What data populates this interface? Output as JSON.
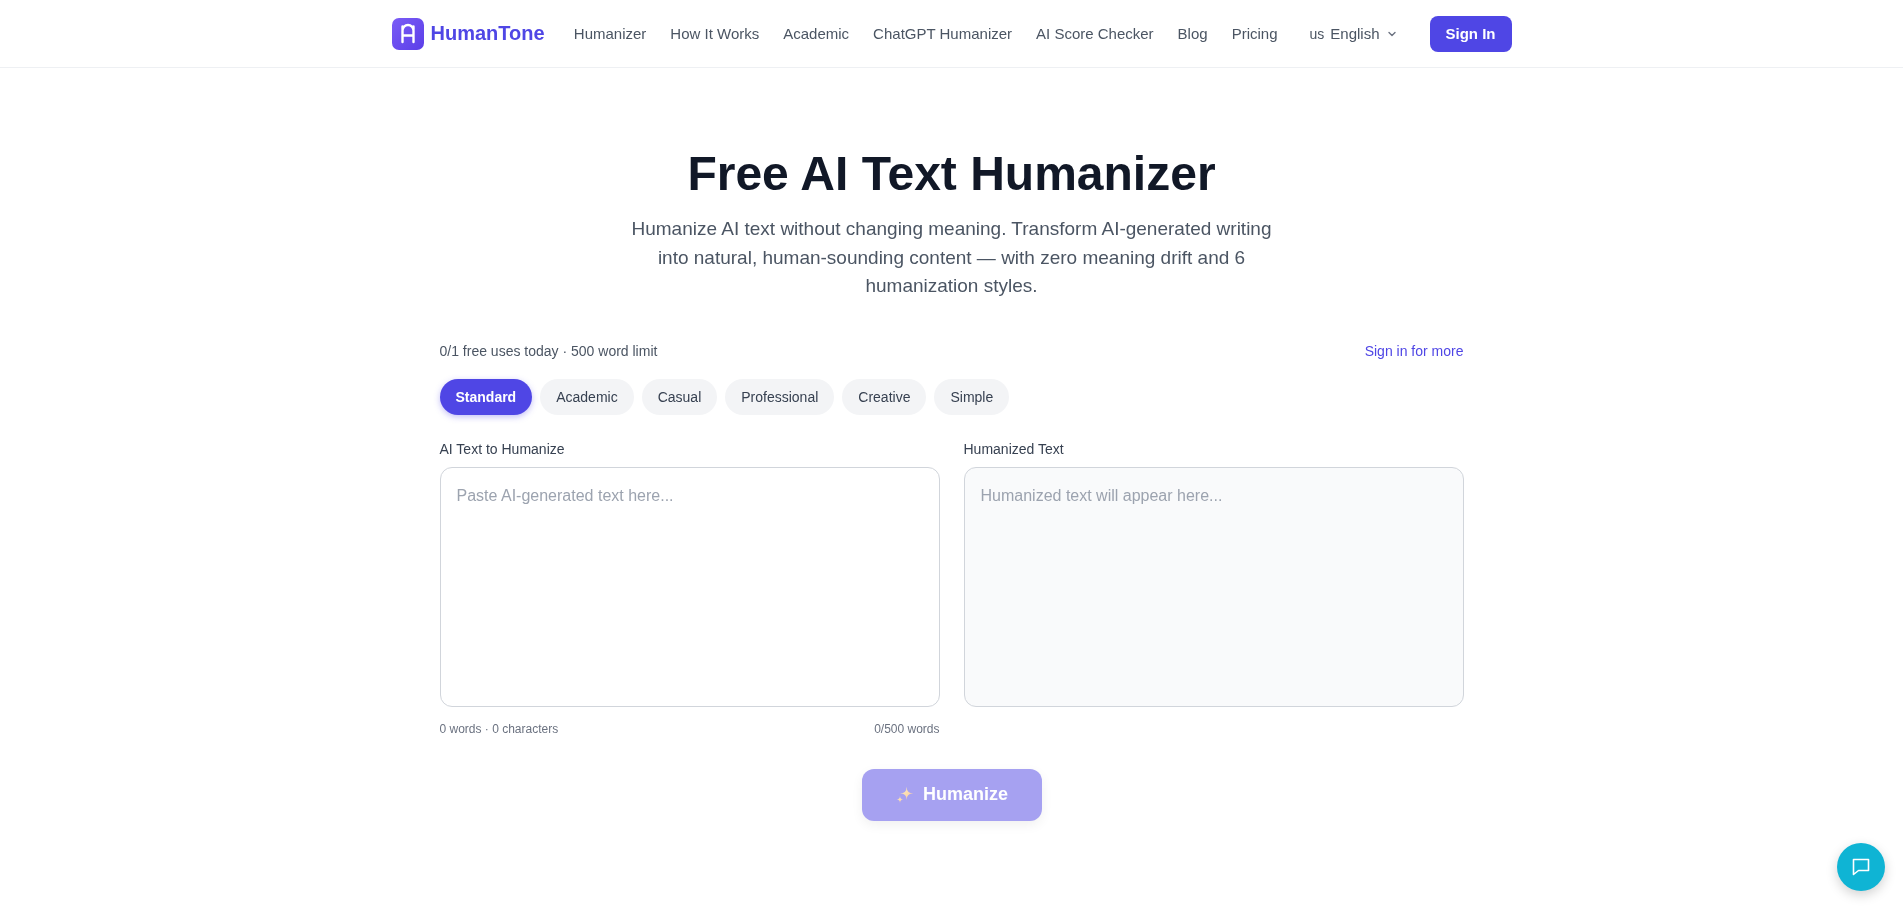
{
  "header": {
    "brand": "HumanTone",
    "nav": [
      {
        "label": "Humanizer"
      },
      {
        "label": "How It Works"
      },
      {
        "label": "Academic"
      },
      {
        "label": "ChatGPT Humanizer"
      },
      {
        "label": "AI Score Checker"
      },
      {
        "label": "Blog"
      },
      {
        "label": "Pricing"
      }
    ],
    "language": {
      "flag": "us",
      "label": "English"
    },
    "sign_in": "Sign In"
  },
  "hero": {
    "title": "Free AI Text Humanizer",
    "subtitle": "Humanize AI text without changing meaning. Transform AI-generated writing into natural, human-sounding content — with zero meaning drift and 6 humanization styles."
  },
  "usage": {
    "text": "0/1 free uses today · 500 word limit",
    "link": "Sign in for more"
  },
  "styles": [
    {
      "label": "Standard",
      "selected": true
    },
    {
      "label": "Academic",
      "selected": false
    },
    {
      "label": "Casual",
      "selected": false
    },
    {
      "label": "Professional",
      "selected": false
    },
    {
      "label": "Creative",
      "selected": false
    },
    {
      "label": "Simple",
      "selected": false
    }
  ],
  "panels": [
    {
      "kind": "input",
      "label": "AI Text to Humanize",
      "placeholder": "Paste AI-generated text here...",
      "stats": "0 words · 0 characters",
      "limit": "0/500 words"
    },
    {
      "kind": "output",
      "label": "Humanized Text",
      "placeholder": "Humanized text will appear here..."
    }
  ],
  "humanize_button": {
    "label": "Humanize",
    "disabled": true
  }
}
